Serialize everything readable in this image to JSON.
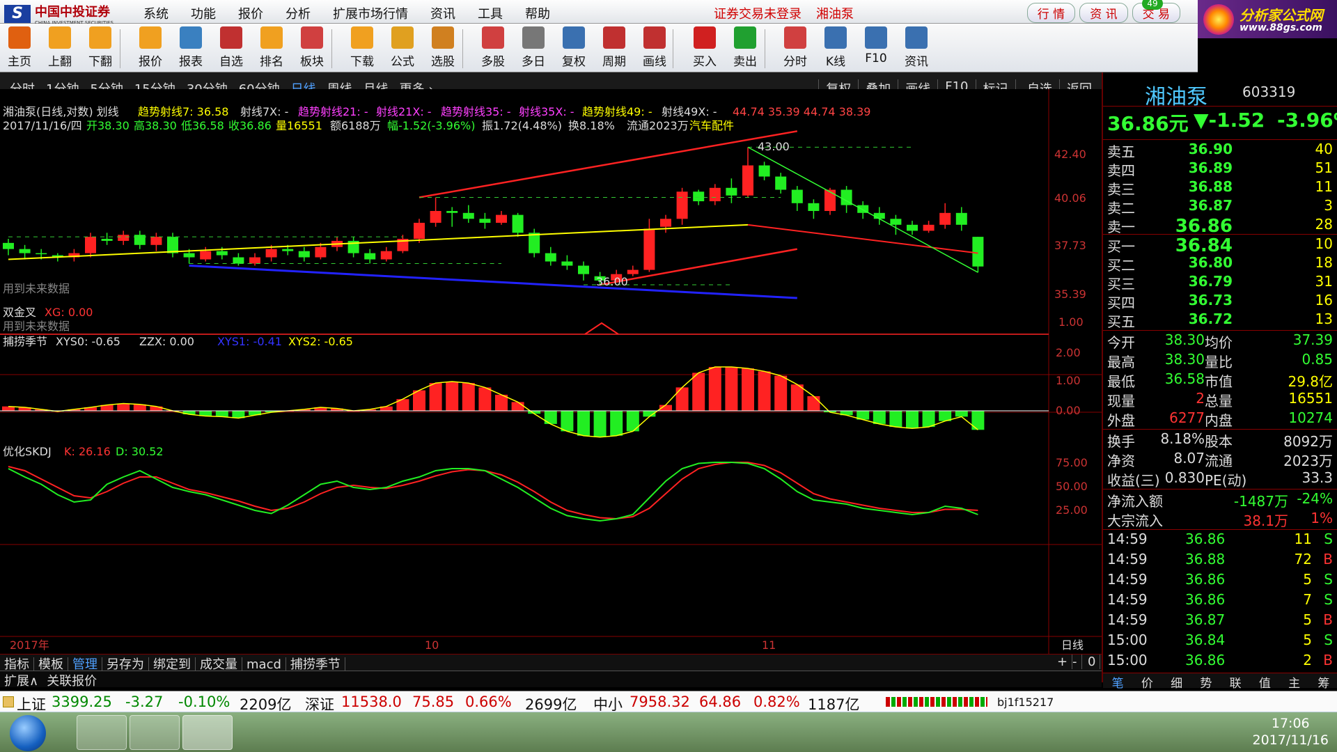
{
  "app": {
    "name": "中国中投证券",
    "name_en": "CHINA INVESTMENT SECURITIES",
    "login_status": "证券交易未登录",
    "current_stock_title": "湘油泵"
  },
  "menu": [
    "系统",
    "功能",
    "报价",
    "分析",
    "扩展市场行情",
    "资讯",
    "工具",
    "帮助"
  ],
  "top_buttons": [
    "行 情",
    "资 讯",
    "交 易"
  ],
  "top_badge": "49",
  "ad": {
    "line1": "分析家公式网",
    "line2": "www.88gs.com"
  },
  "toolbar": [
    {
      "label": "主页",
      "icon": "home-icon",
      "color": "#e06010"
    },
    {
      "label": "上翻",
      "icon": "arrow-up-icon",
      "color": "#f0a020"
    },
    {
      "label": "下翻",
      "icon": "arrow-down-icon",
      "color": "#f0a020"
    },
    {
      "label": "报价",
      "icon": "yen-icon",
      "color": "#f0a020"
    },
    {
      "label": "报表",
      "icon": "report-icon",
      "color": "#3a80c0"
    },
    {
      "label": "自选",
      "icon": "f6-icon",
      "color": "#c03030"
    },
    {
      "label": "排名",
      "icon": "rank-icon",
      "color": "#f0a020"
    },
    {
      "label": "板块",
      "icon": "blocks-icon",
      "color": "#d04040"
    },
    {
      "label": "下载",
      "icon": "download-icon",
      "color": "#f0a020"
    },
    {
      "label": "公式",
      "icon": "formula-icon",
      "color": "#e0a020"
    },
    {
      "label": "选股",
      "icon": "pick-stock-icon",
      "color": "#d08020"
    },
    {
      "label": "多股",
      "icon": "multi-stock-icon",
      "color": "#d04040"
    },
    {
      "label": "多日",
      "icon": "clock-icon",
      "color": "#777"
    },
    {
      "label": "复权",
      "icon": "adjust-icon",
      "color": "#3a70b0"
    },
    {
      "label": "周期",
      "icon": "f8-icon",
      "color": "#c03030"
    },
    {
      "label": "画线",
      "icon": "draw-line-icon",
      "color": "#c03030"
    },
    {
      "label": "买入",
      "icon": "buy-icon",
      "color": "#d02020"
    },
    {
      "label": "卖出",
      "icon": "sell-icon",
      "color": "#20a030"
    },
    {
      "label": "分时",
      "icon": "intraday-icon",
      "color": "#d04040"
    },
    {
      "label": "K线",
      "icon": "kline-icon",
      "color": "#3a70b0"
    },
    {
      "label": "F10",
      "icon": "f10-icon",
      "color": "#3a70b0"
    },
    {
      "label": "资讯",
      "icon": "news-icon",
      "color": "#3a70b0"
    }
  ],
  "period_tabs": [
    "分时",
    "1分钟",
    "5分钟",
    "15分钟",
    "30分钟",
    "60分钟",
    "日线",
    "周线",
    "月线",
    "更多 ›"
  ],
  "active_period": "日线",
  "chart_tools": [
    "复权",
    "叠加",
    "画线",
    "F10",
    "标记",
    "-自选",
    "返回"
  ],
  "chart_header": {
    "line1_prefix": "湘油泵(日线,对数) 划线",
    "trend7": "趋势射线7: 36.58",
    "ray7x": "射线7X: -",
    "trend21": "趋势射线21: -",
    "ray21x": "射线21X: -",
    "trend35": "趋势射线35: -",
    "ray35x": "射线35X: -",
    "trend49": "趋势射线49: -",
    "ray49x": "射线49X: -",
    "vals": "44.74  35.39  44.74  38.39",
    "line2_date": "2017/11/16/四",
    "open": "开38.30",
    "high": "高38.30",
    "low": "低36.58",
    "close": "收36.86",
    "vol": "量16551",
    "amount": "额6188万",
    "amp_chg": "幅-1.52(-3.96%)",
    "swing": "振1.72(4.48%)",
    "turnover": "换8.18%",
    "float": "流通2023万",
    "sector": "汽车配件"
  },
  "main_chart": {
    "y_labels": [
      "42.40",
      "40.06",
      "37.73",
      "35.39"
    ],
    "peak_label": "43.00",
    "trough_label": "36.00",
    "future_note": "用到未来数据"
  },
  "sub1": {
    "name": "双金叉",
    "xg": "XG: 0.00",
    "note": "用到未来数据",
    "y_label": "1.00"
  },
  "sub2": {
    "name": "捕捞季节",
    "xys0": "XYS0: -0.65",
    "zzx": "ZZX: 0.00",
    "xys1": "XYS1: -0.41",
    "xys2": "XYS2: -0.65",
    "y_labels": [
      "2.00",
      "1.00",
      "0.00"
    ]
  },
  "sub3": {
    "name": "优化SKDJ",
    "k": "K: 26.16",
    "d": "D: 30.52",
    "y_labels": [
      "75.00",
      "50.00",
      "25.00"
    ]
  },
  "x_axis": {
    "year": "2017年",
    "m10": "10",
    "m11": "11",
    "period": "日线"
  },
  "bottom_tabs": [
    "指标",
    "模板",
    "管理",
    "另存为",
    "绑定到",
    "成交量",
    "macd",
    "捕捞季节"
  ],
  "bottom_controls": [
    "+",
    "-",
    "0"
  ],
  "ext_row": [
    "扩展∧",
    "关联报价"
  ],
  "quote": {
    "name": "湘油泵",
    "code": "603319",
    "price": "36.86元",
    "change": "▼-1.52",
    "pct": "-3.96%",
    "asks": [
      {
        "label": "卖五",
        "price": "36.90",
        "vol": "40"
      },
      {
        "label": "卖四",
        "price": "36.89",
        "vol": "51"
      },
      {
        "label": "卖三",
        "price": "36.88",
        "vol": "11"
      },
      {
        "label": "卖二",
        "price": "36.87",
        "vol": "3"
      },
      {
        "label": "卖一",
        "price": "36.86",
        "vol": "28"
      }
    ],
    "bids": [
      {
        "label": "买一",
        "price": "36.84",
        "vol": "10"
      },
      {
        "label": "买二",
        "price": "36.80",
        "vol": "18"
      },
      {
        "label": "买三",
        "price": "36.79",
        "vol": "31"
      },
      {
        "label": "买四",
        "price": "36.73",
        "vol": "16"
      },
      {
        "label": "买五",
        "price": "36.72",
        "vol": "13"
      }
    ],
    "stats": [
      {
        "l1": "今开",
        "v1": "38.30",
        "l2": "均价",
        "v2": "37.39"
      },
      {
        "l1": "最高",
        "v1": "38.30",
        "l2": "量比",
        "v2": "0.85"
      },
      {
        "l1": "最低",
        "v1": "36.58",
        "l2": "市值",
        "v2": "29.8亿"
      },
      {
        "l1": "现量",
        "v1": "2",
        "l2": "总量",
        "v2": "16551"
      },
      {
        "l1": "外盘",
        "v1": "6277",
        "l2": "内盘",
        "v2": "10274"
      }
    ],
    "stats2": [
      {
        "l1": "换手",
        "v1": "8.18%",
        "l2": "股本",
        "v2": "8092万"
      },
      {
        "l1": "净资",
        "v1": "8.07",
        "l2": "流通",
        "v2": "2023万"
      },
      {
        "l1": "收益(三)",
        "v1": "0.830",
        "l2": "PE(动)",
        "v2": "33.3"
      }
    ],
    "flow": [
      {
        "l": "净流入额",
        "v1": "-1487万",
        "v2": "-24%"
      },
      {
        "l": "大宗流入",
        "v1": "38.1万",
        "v2": "1%"
      }
    ],
    "ticks": [
      {
        "t": "14:59",
        "p": "36.86",
        "v": "11",
        "s": "S"
      },
      {
        "t": "14:59",
        "p": "36.88",
        "v": "72",
        "s": "B"
      },
      {
        "t": "14:59",
        "p": "36.86",
        "v": "5",
        "s": "S"
      },
      {
        "t": "14:59",
        "p": "36.86",
        "v": "7",
        "s": "S"
      },
      {
        "t": "14:59",
        "p": "36.87",
        "v": "5",
        "s": "B"
      },
      {
        "t": "15:00",
        "p": "36.84",
        "v": "5",
        "s": "S"
      },
      {
        "t": "15:00",
        "p": "36.86",
        "v": "2",
        "s": "B"
      }
    ],
    "tabs": [
      "笔",
      "价",
      "细",
      "势",
      "联",
      "值",
      "主",
      "筹"
    ]
  },
  "index_bar": {
    "sh_name": "上证",
    "sh_val": "3399.25",
    "sh_chg": "-3.27",
    "sh_pct": "-0.10%",
    "sh_amt": "2209亿",
    "sz_name": "深证",
    "sz_val": "11538.0",
    "sz_chg": "75.85",
    "sz_pct": "0.66%",
    "sz_amt": "2699亿",
    "zx_name": "中小",
    "zx_val": "7958.32",
    "zx_chg": "64.86",
    "zx_pct": "0.82%",
    "zx_amt": "1187亿",
    "user": "bj1f15217"
  },
  "taskbar": {
    "time": "17:06",
    "date": "2017/11/16"
  },
  "candles": [
    [
      38.0,
      37.7,
      38.2,
      37.4
    ],
    [
      37.7,
      37.5,
      37.9,
      37.2
    ],
    [
      37.5,
      37.45,
      37.7,
      37.2
    ],
    [
      37.4,
      37.3,
      37.5,
      37.1
    ],
    [
      37.3,
      37.5,
      37.7,
      37.1
    ],
    [
      37.5,
      38.3,
      38.5,
      37.3
    ],
    [
      38.2,
      38.1,
      38.5,
      37.9
    ],
    [
      38.1,
      38.4,
      38.6,
      37.9
    ],
    [
      38.4,
      37.9,
      38.6,
      37.7
    ],
    [
      37.9,
      38.3,
      38.5,
      37.6
    ],
    [
      38.3,
      37.5,
      38.5,
      37.3
    ],
    [
      37.5,
      37.3,
      37.7,
      37.0
    ],
    [
      37.2,
      37.6,
      37.8,
      37.1
    ],
    [
      37.6,
      37.4,
      37.8,
      37.2
    ],
    [
      37.3,
      37.0,
      37.5,
      36.9
    ],
    [
      37.0,
      37.3,
      37.5,
      36.9
    ],
    [
      37.3,
      37.7,
      37.9,
      37.1
    ],
    [
      37.7,
      37.6,
      37.9,
      37.4
    ],
    [
      37.6,
      37.3,
      37.8,
      37.1
    ],
    [
      37.3,
      37.8,
      38.0,
      37.2
    ],
    [
      37.8,
      38.1,
      38.3,
      37.6
    ],
    [
      38.1,
      37.5,
      38.3,
      37.3
    ],
    [
      37.5,
      37.2,
      37.7,
      37.0
    ],
    [
      37.2,
      37.6,
      37.8,
      37.1
    ],
    [
      37.6,
      38.2,
      38.4,
      37.5
    ],
    [
      38.2,
      39.0,
      39.2,
      38.0
    ],
    [
      39.0,
      39.6,
      40.3,
      38.8
    ],
    [
      39.6,
      39.5,
      39.8,
      38.8
    ],
    [
      39.5,
      39.2,
      39.9,
      39.0
    ],
    [
      39.2,
      39.0,
      39.5,
      38.7
    ],
    [
      39.0,
      39.4,
      39.6,
      38.9
    ],
    [
      39.4,
      38.5,
      39.5,
      38.3
    ],
    [
      38.5,
      37.5,
      38.7,
      37.3
    ],
    [
      37.5,
      37.1,
      37.8,
      36.9
    ],
    [
      37.1,
      36.9,
      37.4,
      36.7
    ],
    [
      36.9,
      36.5,
      37.1,
      36.2
    ],
    [
      36.4,
      36.2,
      36.6,
      36.0
    ],
    [
      36.2,
      36.5,
      36.7,
      36.1
    ],
    [
      36.5,
      36.7,
      36.9,
      36.4
    ],
    [
      36.7,
      38.7,
      39.2,
      36.6
    ],
    [
      38.8,
      39.2,
      39.4,
      38.5
    ],
    [
      39.2,
      40.6,
      40.8,
      38.9
    ],
    [
      40.6,
      40.1,
      40.7,
      39.9
    ],
    [
      40.1,
      40.8,
      41.0,
      39.9
    ],
    [
      40.8,
      40.4,
      41.3,
      40.0
    ],
    [
      40.4,
      42.0,
      43.0,
      40.3
    ],
    [
      42.0,
      41.4,
      42.2,
      41.2
    ],
    [
      41.4,
      40.7,
      41.6,
      40.5
    ],
    [
      40.7,
      40.0,
      40.9,
      39.6
    ],
    [
      40.0,
      39.6,
      40.2,
      39.2
    ],
    [
      39.6,
      40.7,
      40.8,
      39.4
    ],
    [
      40.7,
      39.9,
      40.9,
      39.5
    ],
    [
      39.9,
      39.5,
      40.1,
      39.2
    ],
    [
      39.5,
      39.2,
      39.8,
      38.9
    ],
    [
      39.2,
      38.9,
      39.4,
      38.4
    ],
    [
      38.9,
      38.6,
      39.1,
      38.4
    ],
    [
      38.6,
      38.9,
      39.1,
      38.5
    ],
    [
      38.9,
      39.5,
      40.0,
      38.7
    ],
    [
      39.5,
      38.9,
      39.8,
      38.6
    ],
    [
      38.3,
      36.86,
      38.3,
      36.58
    ]
  ],
  "bl_series": [
    0.15,
    0.12,
    0.05,
    -0.02,
    0.05,
    0.12,
    0.2,
    0.25,
    0.22,
    0.15,
    0.0,
    -0.12,
    -0.18,
    -0.2,
    -0.25,
    -0.15,
    -0.05,
    0.0,
    0.05,
    0.12,
    0.08,
    0.0,
    0.05,
    0.15,
    0.4,
    0.7,
    0.95,
    1.0,
    0.95,
    0.8,
    0.55,
    0.3,
    -0.1,
    -0.45,
    -0.7,
    -0.85,
    -0.9,
    -0.85,
    -0.7,
    -0.2,
    0.2,
    0.8,
    1.3,
    1.5,
    1.5,
    1.45,
    1.35,
    1.2,
    0.9,
    0.5,
    -0.05,
    -0.15,
    -0.3,
    -0.45,
    -0.55,
    -0.6,
    -0.55,
    -0.35,
    -0.2,
    -0.65
  ],
  "kdj_k": [
    70,
    62,
    55,
    45,
    38,
    40,
    55,
    62,
    68,
    60,
    52,
    48,
    45,
    40,
    35,
    30,
    27,
    35,
    45,
    55,
    58,
    52,
    50,
    52,
    58,
    62,
    68,
    70,
    70,
    68,
    60,
    52,
    42,
    32,
    25,
    22,
    20,
    22,
    26,
    42,
    58,
    70,
    75,
    76,
    76,
    75,
    70,
    60,
    48,
    40,
    38,
    36,
    32,
    30,
    28,
    26,
    28,
    34,
    32,
    26
  ],
  "kdj_d": [
    72,
    68,
    60,
    52,
    44,
    42,
    48,
    56,
    62,
    62,
    56,
    50,
    47,
    43,
    39,
    34,
    30,
    32,
    38,
    46,
    52,
    54,
    52,
    51,
    54,
    58,
    63,
    67,
    69,
    68,
    64,
    57,
    48,
    38,
    30,
    26,
    23,
    22,
    24,
    32,
    46,
    60,
    70,
    74,
    76,
    76,
    73,
    66,
    56,
    46,
    41,
    38,
    35,
    32,
    30,
    28,
    28,
    31,
    31,
    30
  ]
}
